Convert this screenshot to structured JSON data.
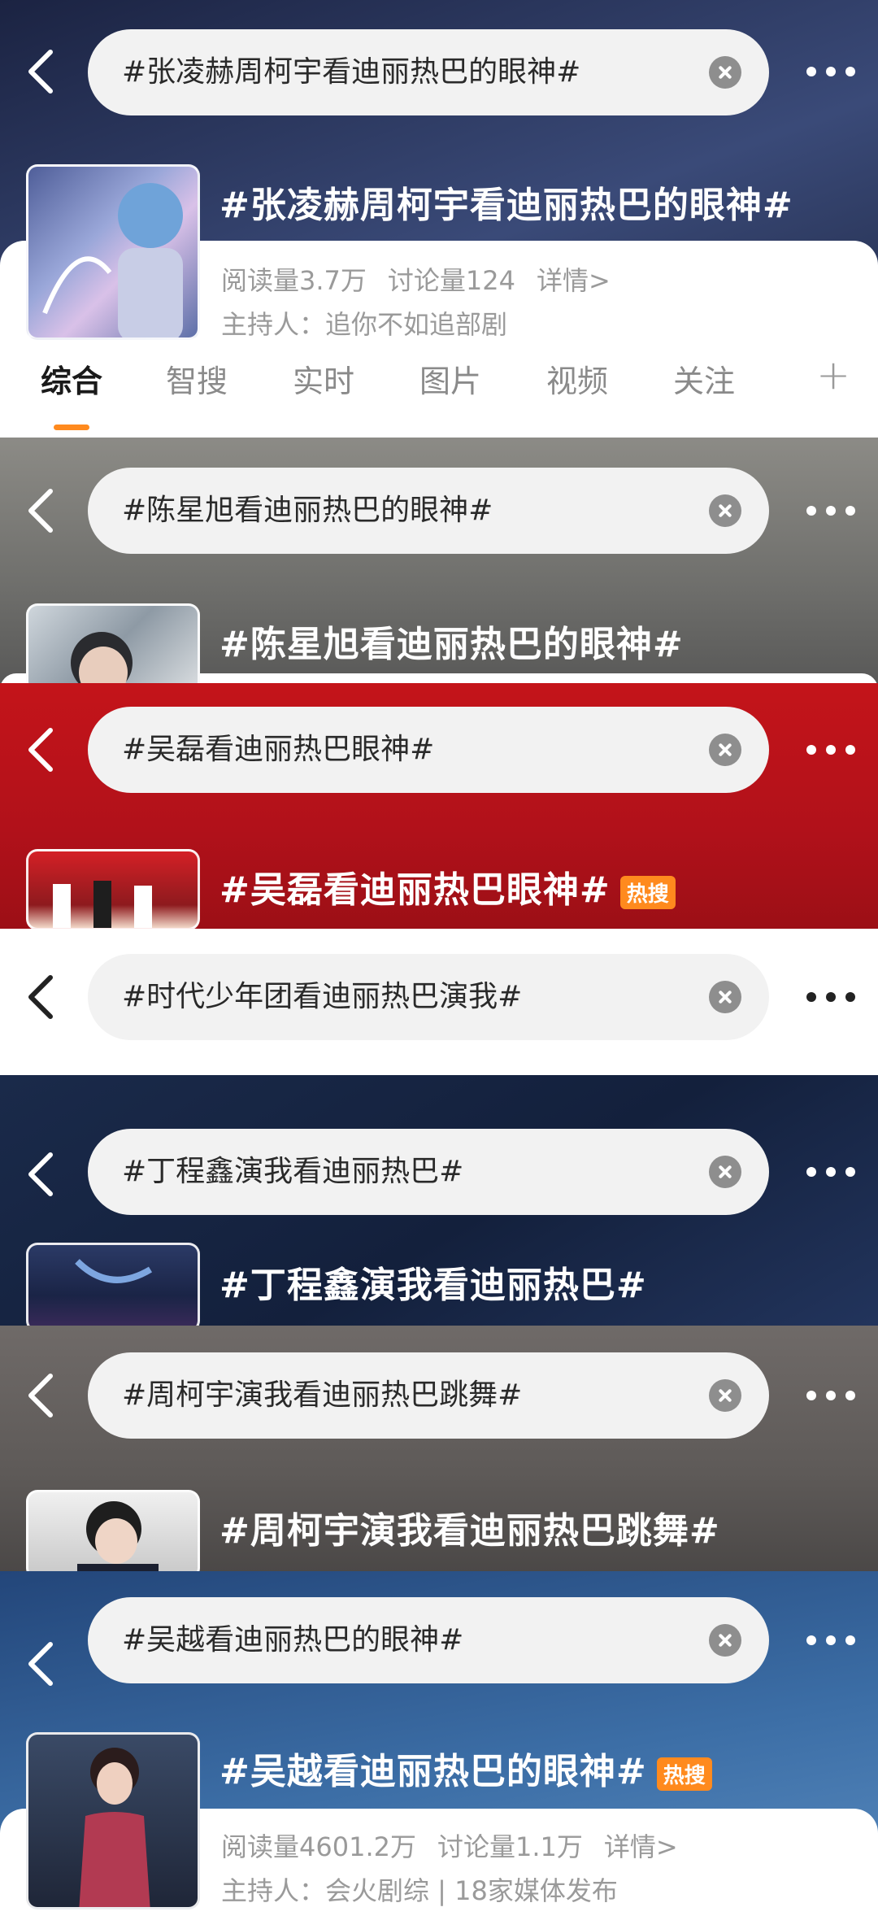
{
  "panels": [
    {
      "search_text": "#张凌赫周柯宇看迪丽热巴的眼神#",
      "topic_title": "#张凌赫周柯宇看迪丽热巴的眼神#",
      "reads": "阅读量3.7万",
      "discussions": "讨论量124",
      "details": "详情>",
      "host": "主持人：追你不如追部剧",
      "tabs": [
        "综合",
        "智搜",
        "实时",
        "图片",
        "视频",
        "关注"
      ],
      "add_tab_icon": "plus-icon"
    },
    {
      "search_text": "#陈星旭看迪丽热巴的眼神#",
      "topic_title": "#陈星旭看迪丽热巴的眼神#"
    },
    {
      "search_text": "#吴磊看迪丽热巴眼神#",
      "topic_title": "#吴磊看迪丽热巴眼神#",
      "badge": "热搜"
    },
    {
      "search_text": "#时代少年团看迪丽热巴演我#"
    },
    {
      "search_text": "#丁程鑫演我看迪丽热巴#",
      "topic_title": "#丁程鑫演我看迪丽热巴#"
    },
    {
      "search_text": "#周柯宇演我看迪丽热巴跳舞#",
      "topic_title": "#周柯宇演我看迪丽热巴跳舞#"
    },
    {
      "search_text": "#吴越看迪丽热巴的眼神#",
      "topic_title": "#吴越看迪丽热巴的眼神#",
      "badge": "热搜",
      "reads": "阅读量4601.2万",
      "discussions": "讨论量1.1万",
      "details": "详情>",
      "host": "主持人：会火剧综 | 18家媒体发布"
    }
  ],
  "icons": {
    "back": "back-arrow-icon",
    "clear": "clear-icon",
    "more": "more-dots-icon"
  },
  "colors": {
    "accent": "#ff8a1e",
    "hot_badge": "#ff8a1e"
  }
}
